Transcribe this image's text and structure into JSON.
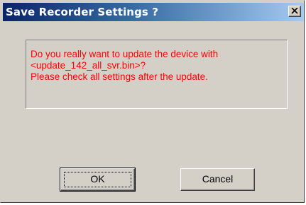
{
  "window": {
    "title": "Save Recorder Settings ?",
    "close_icon": "close-icon"
  },
  "message": {
    "lines": [
      "Do you really want to update the device with",
      "<update_142_all_svr.bin>?",
      "Please check all settings after the update."
    ],
    "color": "#ff0000"
  },
  "buttons": {
    "ok_label": "OK",
    "cancel_label": "Cancel"
  },
  "colors": {
    "title_gradient_start": "#0a246a",
    "title_gradient_end": "#a6caf0",
    "dialog_face": "#d4d0c8"
  }
}
